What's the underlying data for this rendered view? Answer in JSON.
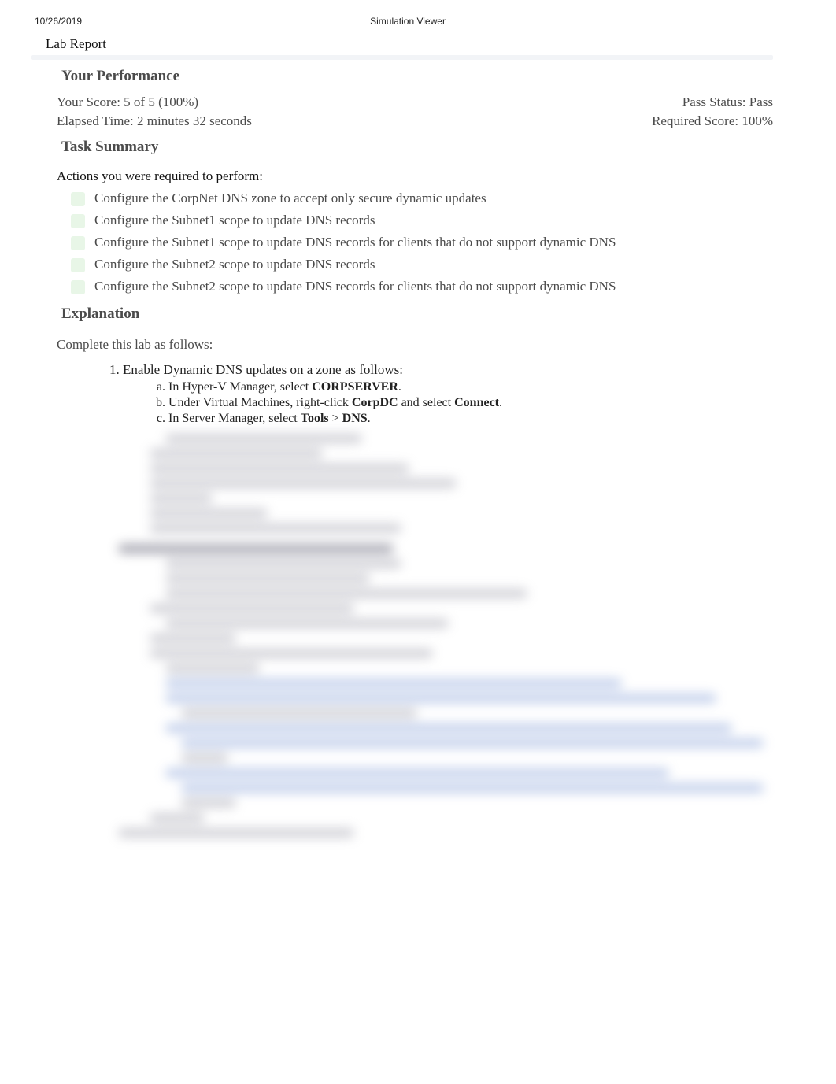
{
  "header": {
    "date": "10/26/2019",
    "title": "Simulation Viewer",
    "lab_report": "Lab Report"
  },
  "performance": {
    "heading": "Your Performance",
    "score_label": "Your Score: 5 of 5 (100%)",
    "pass_status": "Pass Status: Pass",
    "elapsed": "Elapsed Time: 2 minutes 32 seconds",
    "required": "Required Score: 100%"
  },
  "task_summary": {
    "heading": "Task Summary",
    "actions_heading": "Actions you were required to perform:",
    "actions": [
      "Configure the CorpNet DNS zone to accept only secure dynamic updates",
      "Configure the Subnet1 scope to update DNS records",
      "Configure the Subnet1 scope to update DNS records for clients that do not support dynamic DNS",
      "Configure the Subnet2 scope to update DNS records",
      "Configure the Subnet2 scope to update DNS records for clients that do not support dynamic DNS"
    ]
  },
  "explanation": {
    "heading": "Explanation",
    "intro": "Complete this lab as follows:",
    "step1_title": "Enable Dynamic DNS updates on a zone as follows:",
    "step1_a_pre": "In Hyper-V Manager, select ",
    "step1_a_bold": "CORPSERVER",
    "step1_a_post": ".",
    "step1_b_pre": "Under Virtual Machines, right-click ",
    "step1_b_bold1": "CorpDC",
    "step1_b_mid": " and select ",
    "step1_b_bold2": "Connect",
    "step1_b_post": ".",
    "step1_c_pre": "In Server Manager, select ",
    "step1_c_bold1": "Tools",
    "step1_c_mid": " > ",
    "step1_c_bold2": "DNS",
    "step1_c_post": "."
  }
}
